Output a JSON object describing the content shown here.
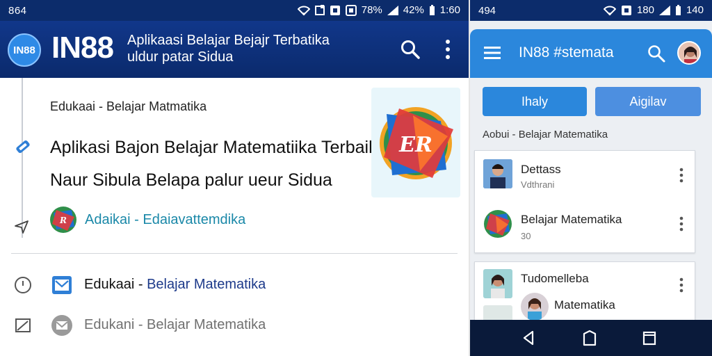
{
  "left": {
    "status": {
      "time": "864",
      "battery": "78%",
      "signal": "42%",
      "clock": "1:60"
    },
    "appbar": {
      "logo_text": "IN88",
      "brand": "IN88",
      "title_line1": "Aplikaasi Belajar Bejajr Terbatika",
      "title_line2": "uldur patar Sidua"
    },
    "breadcrumb": "Edukaai - Belajar Matmatika",
    "headline": "Aplikasi Bajon Belajar Matematiika Terbaik",
    "subline": "Naur Sibula  Belapa palur ueur Sidua",
    "hero_logo_text": "ER",
    "app_link": "Adaikai - Edaiavattemdika",
    "rows": [
      {
        "part1": "Edukaai - ",
        "part2": "Belajar Matematika"
      },
      {
        "text": "Edukani - Belajar Matematika"
      }
    ],
    "colors": {
      "appbar": "#0c2c6b",
      "link": "#1a88a8",
      "accent": "#1d3a8a"
    }
  },
  "right": {
    "status": {
      "time": "494",
      "battery": "180",
      "clock": "140"
    },
    "appbar": {
      "title": "IN88 #stemata"
    },
    "buttons": [
      {
        "label": "Ihaly"
      },
      {
        "label": "Aigilav"
      }
    ],
    "breadcrumb": "Aobui - Belajar Matematika",
    "card1": [
      {
        "title": "Dettass",
        "subtitle": "Vdthrani"
      },
      {
        "title": "Belajar Matematika",
        "subtitle": "30"
      }
    ],
    "card2": [
      {
        "title": "Tudomelleba"
      },
      {
        "title": "Matematika"
      }
    ],
    "colors": {
      "appbar": "#2b87dc",
      "nav": "#0a1a3a"
    }
  }
}
